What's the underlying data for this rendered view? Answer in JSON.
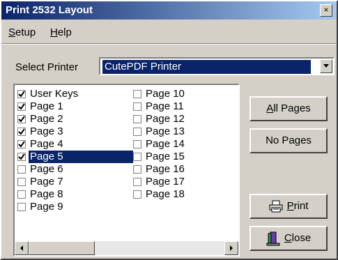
{
  "window": {
    "title": "Print 2532 Layout",
    "close_glyph": "×"
  },
  "menu": [
    {
      "accel": "S",
      "rest": "etup"
    },
    {
      "accel": "H",
      "rest": "elp"
    }
  ],
  "printer": {
    "label": "Select Printer",
    "value": "CutePDF Printer"
  },
  "pages_col1": [
    {
      "label": "User Keys",
      "checked": true
    },
    {
      "label": "Page 1",
      "checked": true
    },
    {
      "label": "Page 2",
      "checked": true
    },
    {
      "label": "Page 3",
      "checked": true
    },
    {
      "label": "Page 4",
      "checked": true
    },
    {
      "label": "Page 5",
      "checked": true,
      "selected": true
    },
    {
      "label": "Page 6",
      "checked": false
    },
    {
      "label": "Page 7",
      "checked": false
    },
    {
      "label": "Page 8",
      "checked": false
    },
    {
      "label": "Page 9",
      "checked": false
    }
  ],
  "pages_col2": [
    {
      "label": "Page 10",
      "checked": false
    },
    {
      "label": "Page 11",
      "checked": false
    },
    {
      "label": "Page 12",
      "checked": false
    },
    {
      "label": "Page 13",
      "checked": false
    },
    {
      "label": "Page 14",
      "checked": false
    },
    {
      "label": "Page 15",
      "checked": false
    },
    {
      "label": "Page 16",
      "checked": false
    },
    {
      "label": "Page 17",
      "checked": false
    },
    {
      "label": "Page 18",
      "checked": false
    }
  ],
  "buttons": {
    "all_pages": {
      "accel": "A",
      "rest": "ll Pages"
    },
    "no_pages": {
      "label": "No Pages"
    },
    "print": {
      "accel": "P",
      "rest": "rint",
      "icon": "printer-icon"
    },
    "close": {
      "accel": "C",
      "rest": "lose",
      "icon": "close-door-icon"
    }
  },
  "colors": {
    "selection": "#0a246a",
    "face": "#d4d0c8",
    "title_start": "#0a246a",
    "title_end": "#a6caf0"
  }
}
